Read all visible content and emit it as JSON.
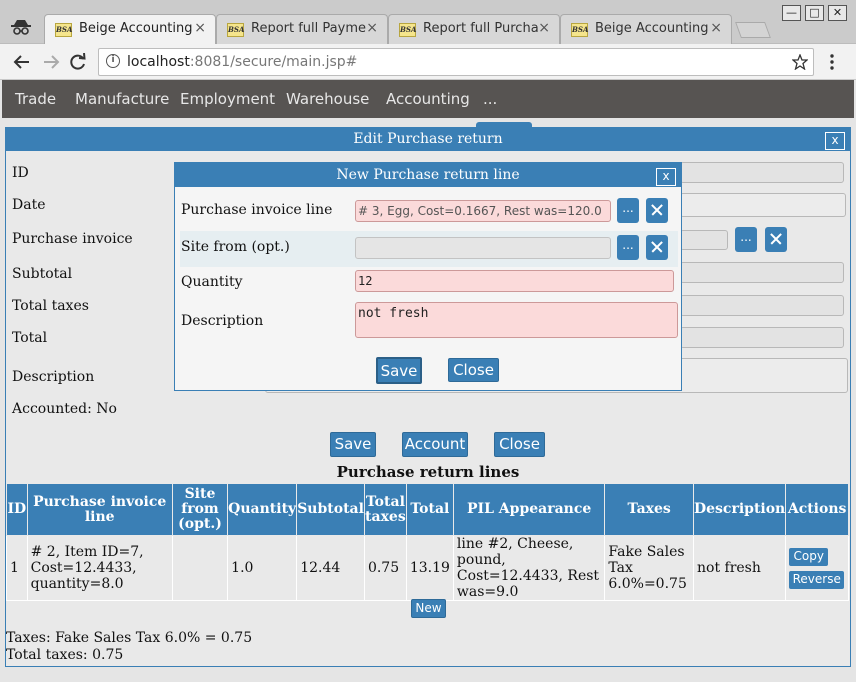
{
  "browser": {
    "tabs": [
      {
        "label": "Beige Accounting",
        "favicon": "BSA"
      },
      {
        "label": "Report full Payme",
        "favicon": "BSA"
      },
      {
        "label": "Report full Purcha",
        "favicon": "BSA"
      },
      {
        "label": "Beige Accounting",
        "favicon": "BSA"
      }
    ],
    "close_glyph": "×",
    "url_host": "localhost",
    "url_path": ":8081/secure/main.jsp#"
  },
  "nav": {
    "items": [
      "Trade",
      "Manufacture",
      "Employment",
      "Warehouse",
      "Accounting",
      "..."
    ]
  },
  "edit_panel": {
    "title": "Edit Purchase return",
    "close_label": "x",
    "fields": {
      "id": "ID",
      "date": "Date",
      "purchase_invoice": "Purchase invoice",
      "subtotal": "Subtotal",
      "total_taxes": "Total taxes",
      "total": "Total",
      "description": "Description",
      "accounted": "Accounted: No"
    },
    "browse_label": "...",
    "buttons": {
      "save": "Save",
      "account": "Account",
      "close": "Close"
    },
    "lines_title": "Purchase return lines",
    "table": {
      "headers": [
        "ID",
        "Purchase invoice line",
        "Site from (opt.)",
        "Quantity",
        "Subtotal",
        "Total taxes",
        "Total",
        "PIL Appearance",
        "Taxes",
        "Description",
        "Actions"
      ],
      "rows": [
        {
          "id": "1",
          "invoice_line": "# 2, Item ID=7, Cost=12.4433, quantity=8.0",
          "site_from": "",
          "quantity": "1.0",
          "subtotal": "12.44",
          "total_taxes": "0.75",
          "total": "13.19",
          "appearance": "line #2, Cheese, pound, Cost=12.4433, Rest was=9.0",
          "taxes": "Fake Sales Tax 6.0%=0.75",
          "description": "not fresh",
          "actions": {
            "copy": "Copy",
            "reverse": "Reverse"
          }
        }
      ]
    },
    "new_button": "New",
    "taxes_summary": "Taxes: Fake Sales Tax 6.0% = 0.75",
    "total_taxes_summary": "Total taxes: 0.75"
  },
  "modal": {
    "title": "New Purchase return line",
    "close_label": "x",
    "labels": {
      "invoice_line": "Purchase invoice line",
      "site_from": "Site from (opt.)",
      "quantity": "Quantity",
      "description": "Description"
    },
    "values": {
      "invoice_line": "# 3, Egg, Cost=0.1667, Rest was=120.0",
      "site_from": "",
      "quantity": "12",
      "description": "not fresh"
    },
    "browse_label": "...",
    "buttons": {
      "save": "Save",
      "close": "Close"
    }
  }
}
